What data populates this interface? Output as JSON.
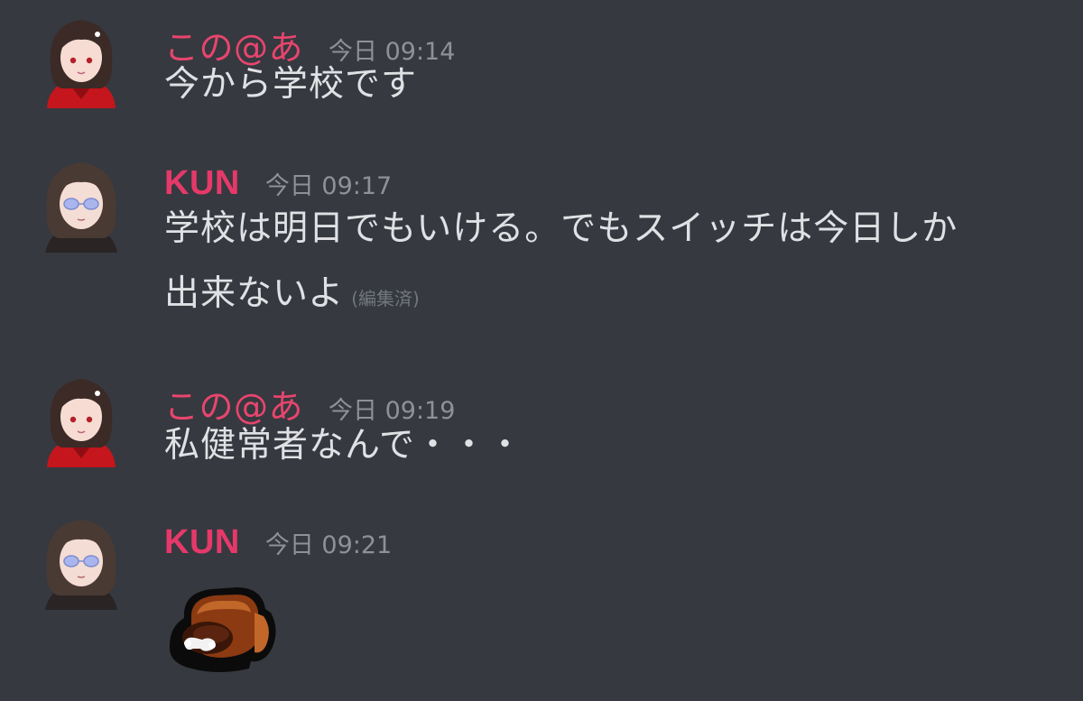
{
  "messages": [
    {
      "author": "この@あ",
      "timestamp": "今日 09:14",
      "text": "今から学校です"
    },
    {
      "author": "KUN",
      "timestamp": "今日 09:17",
      "text_line1": "学校は明日でもいける。でもスイッチは今日しか",
      "text_line2": "出来ないよ",
      "edited_label": "(編集済)"
    },
    {
      "author": "この@あ",
      "timestamp": "今日 09:19",
      "text": "私健常者なんで・・・"
    },
    {
      "author": "KUN",
      "timestamp": "今日 09:21",
      "attachment": "custom-emoji-among-us-crewmate-dead"
    }
  ],
  "colors": {
    "background": "#36393f",
    "author_name": "#e8456e",
    "timestamp": "#8e9297",
    "message_text": "#e0e1e4"
  }
}
